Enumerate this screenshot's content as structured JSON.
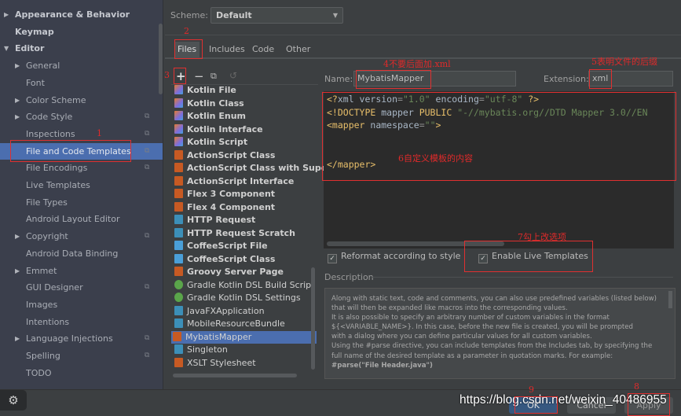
{
  "sidebar": {
    "items": [
      {
        "label": "Appearance & Behavior",
        "level": 0,
        "expandable": true,
        "expanded": false
      },
      {
        "label": "Keymap",
        "level": 0
      },
      {
        "label": "Editor",
        "level": 0,
        "expandable": true,
        "expanded": true
      },
      {
        "label": "General",
        "level": 1,
        "expandable": true
      },
      {
        "label": "Font",
        "level": 1
      },
      {
        "label": "Color Scheme",
        "level": 1,
        "expandable": true
      },
      {
        "label": "Code Style",
        "level": 1,
        "expandable": true,
        "project": true
      },
      {
        "label": "Inspections",
        "level": 1,
        "project": true
      },
      {
        "label": "File and Code Templates",
        "level": 1,
        "project": true,
        "selected": true
      },
      {
        "label": "File Encodings",
        "level": 1,
        "project": true
      },
      {
        "label": "Live Templates",
        "level": 1
      },
      {
        "label": "File Types",
        "level": 1
      },
      {
        "label": "Android Layout Editor",
        "level": 1
      },
      {
        "label": "Copyright",
        "level": 1,
        "expandable": true,
        "project": true
      },
      {
        "label": "Android Data Binding",
        "level": 1
      },
      {
        "label": "Emmet",
        "level": 1,
        "expandable": true
      },
      {
        "label": "GUI Designer",
        "level": 1,
        "project": true
      },
      {
        "label": "Images",
        "level": 1
      },
      {
        "label": "Intentions",
        "level": 1
      },
      {
        "label": "Language Injections",
        "level": 1,
        "expandable": true,
        "project": true
      },
      {
        "label": "Spelling",
        "level": 1,
        "project": true
      },
      {
        "label": "TODO",
        "level": 1
      }
    ]
  },
  "scheme": {
    "label": "Scheme:",
    "value": "Default"
  },
  "tabs": [
    "Files",
    "Includes",
    "Code",
    "Other"
  ],
  "active_tab": "Files",
  "toolbar": {
    "add": "+",
    "remove": "−"
  },
  "templates": [
    {
      "label": "Kotlin File",
      "bold": true,
      "icon": "kotlin"
    },
    {
      "label": "Kotlin Class",
      "bold": true,
      "icon": "kotlin"
    },
    {
      "label": "Kotlin Enum",
      "bold": true,
      "icon": "kotlin"
    },
    {
      "label": "Kotlin Interface",
      "bold": true,
      "icon": "kotlin"
    },
    {
      "label": "Kotlin Script",
      "bold": true,
      "icon": "kotlin"
    },
    {
      "label": "ActionScript Class",
      "bold": true,
      "icon": "orange"
    },
    {
      "label": "ActionScript Class with Supers",
      "bold": true,
      "icon": "orange"
    },
    {
      "label": "ActionScript Interface",
      "bold": true,
      "icon": "orange"
    },
    {
      "label": "Flex 3 Component",
      "bold": true,
      "icon": "orange"
    },
    {
      "label": "Flex 4 Component",
      "bold": true,
      "icon": "orange"
    },
    {
      "label": "HTTP Request",
      "bold": true,
      "icon": "blue"
    },
    {
      "label": "HTTP Request Scratch",
      "bold": true,
      "icon": "blue"
    },
    {
      "label": "CoffeeScript File",
      "bold": true,
      "icon": "coffee"
    },
    {
      "label": "CoffeeScript Class",
      "bold": true,
      "icon": "coffee"
    },
    {
      "label": "Groovy Server Page",
      "bold": true,
      "icon": "orange"
    },
    {
      "label": "Gradle Kotlin DSL Build Script",
      "bold": false,
      "icon": "gradle"
    },
    {
      "label": "Gradle Kotlin DSL Settings",
      "bold": false,
      "icon": "gradle"
    },
    {
      "label": "JavaFXApplication",
      "bold": false,
      "icon": "blue"
    },
    {
      "label": "MobileResourceBundle",
      "bold": false,
      "icon": "blue"
    },
    {
      "label": "MybatisMapper",
      "bold": false,
      "icon": "orange",
      "selected": true
    },
    {
      "label": "Singleton",
      "bold": false,
      "icon": "blue"
    },
    {
      "label": "XSLT Stylesheet",
      "bold": false,
      "icon": "orange"
    }
  ],
  "name_field": {
    "label": "Name:",
    "value": "MybatisMapper"
  },
  "extension_field": {
    "label": "Extension:",
    "value": "xml"
  },
  "code_lines": [
    "<?xml version=\"1.0\" encoding=\"utf-8\" ?>",
    "<!DOCTYPE mapper PUBLIC \"-//mybatis.org//DTD Mapper 3.0//EN",
    "<mapper namespace=\"\">",
    "",
    "",
    "</mapper>"
  ],
  "options": {
    "reformat": {
      "label": "Reformat according to style",
      "checked": true
    },
    "live_templates": {
      "label": "Enable Live Templates",
      "checked": true
    }
  },
  "description": {
    "title": "Description",
    "lines": [
      "Along with static text, code and comments, you can also use predefined variables (listed below)",
      "that will then be expanded like macros into the corresponding values.",
      "It is also possible to specify an arbitrary number of custom variables in the format",
      "${<VARIABLE_NAME>}. In this case, before the new file is created, you will be prompted",
      "with a dialog where you can define particular values for all custom variables.",
      "Using the #parse directive, you can include templates from the Includes tab, by specifying the",
      "full name of the desired template as a parameter in quotation marks. For example:",
      "#parse(\"File Header.java\")"
    ]
  },
  "buttons": {
    "ok": "OK",
    "cancel": "Cancel",
    "apply": "Apply"
  },
  "annotations": {
    "a1": "1",
    "a2": "2",
    "a3": "3",
    "a4": "4不要后面加.xml",
    "a5": "5表明文件的后缀",
    "a6": "6自定义模板的内容",
    "a7": "7勾上改选项",
    "a8": "8",
    "a9": "9"
  },
  "watermark": "https://blog.csdn.net/weixin_40486955",
  "colors": {
    "selection": "#4b6eaf",
    "annotation": "#e03030",
    "editor_bg": "#2b2b2b"
  }
}
